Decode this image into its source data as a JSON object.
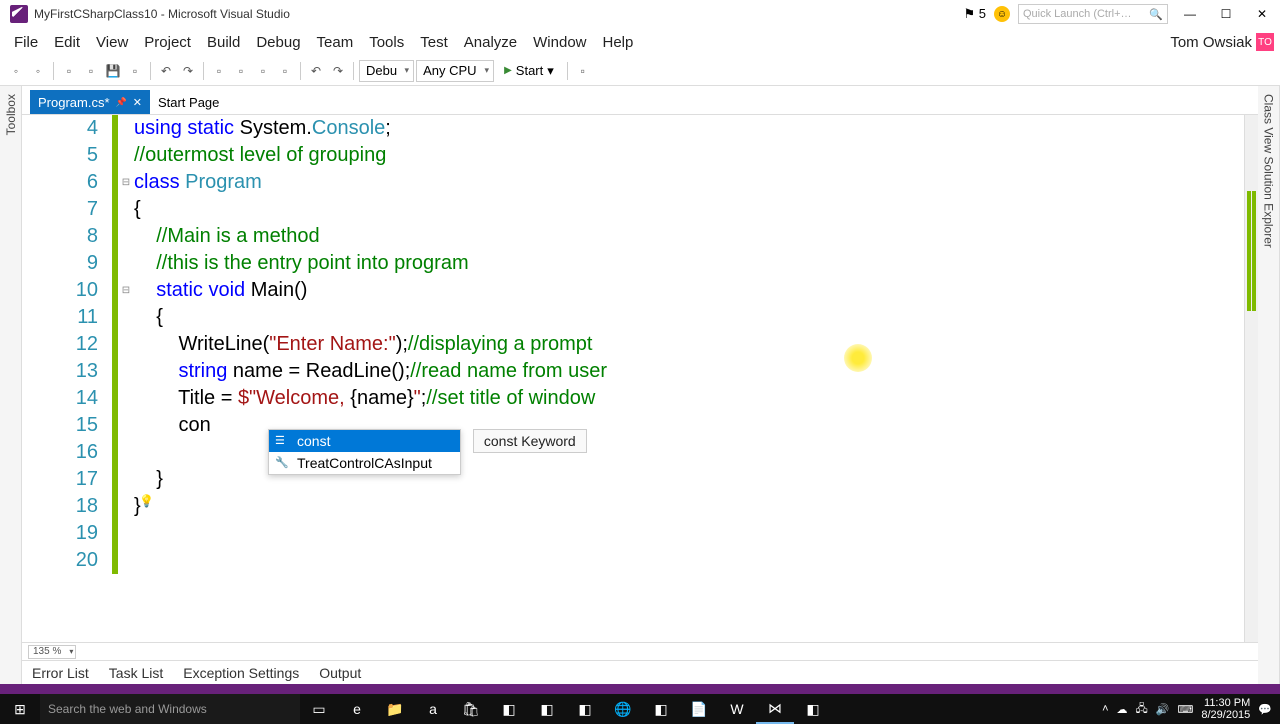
{
  "title": "MyFirstCSharpClass10 - Microsoft Visual Studio",
  "flag_count": "5",
  "quick_launch_placeholder": "Quick Launch (Ctrl+…",
  "menu": [
    "File",
    "Edit",
    "View",
    "Project",
    "Build",
    "Debug",
    "Team",
    "Tools",
    "Test",
    "Analyze",
    "Window",
    "Help"
  ],
  "user_name": "Tom Owsiak",
  "user_initials": "TO",
  "toolbar": {
    "config": "Debu",
    "platform": "Any CPU",
    "start": "Start"
  },
  "tabs": {
    "active_name": "Program.cs*",
    "other": "Start Page"
  },
  "side_left": "Toolbox",
  "side_right_top": "Class View",
  "side_right_bottom": "Solution Explorer",
  "code": {
    "4": [
      {
        "t": "using ",
        "c": "kw"
      },
      {
        "t": "static ",
        "c": "kw"
      },
      {
        "t": "System.",
        "c": "plain"
      },
      {
        "t": "Console",
        "c": "type"
      },
      {
        "t": ";",
        "c": "plain"
      }
    ],
    "5": [
      {
        "t": "//outermost level of grouping",
        "c": "cmt"
      }
    ],
    "6": [
      {
        "t": "class ",
        "c": "kw"
      },
      {
        "t": "Program",
        "c": "type"
      }
    ],
    "7": [
      {
        "t": "{",
        "c": "plain"
      }
    ],
    "8": [
      {
        "t": "    ",
        "c": "plain"
      },
      {
        "t": "//Main is a method",
        "c": "cmt"
      }
    ],
    "9": [
      {
        "t": "    ",
        "c": "plain"
      },
      {
        "t": "//this is the entry point into program",
        "c": "cmt"
      }
    ],
    "10": [
      {
        "t": "    ",
        "c": "plain"
      },
      {
        "t": "static ",
        "c": "kw"
      },
      {
        "t": "void ",
        "c": "kw"
      },
      {
        "t": "Main()",
        "c": "plain"
      }
    ],
    "11": [
      {
        "t": "    {",
        "c": "plain"
      }
    ],
    "12": [
      {
        "t": "        WriteLine(",
        "c": "plain"
      },
      {
        "t": "\"Enter Name:\"",
        "c": "str"
      },
      {
        "t": ");",
        "c": "plain"
      },
      {
        "t": "//displaying a prompt",
        "c": "cmt"
      }
    ],
    "13": [
      {
        "t": "        ",
        "c": "plain"
      },
      {
        "t": "string ",
        "c": "kw"
      },
      {
        "t": "name = ReadLine();",
        "c": "plain"
      },
      {
        "t": "//read name from user",
        "c": "cmt"
      }
    ],
    "14": [
      {
        "t": "        Title = ",
        "c": "plain"
      },
      {
        "t": "$\"Welcome, ",
        "c": "str"
      },
      {
        "t": "{name}",
        "c": "plain"
      },
      {
        "t": "\"",
        "c": "str"
      },
      {
        "t": ";",
        "c": "plain"
      },
      {
        "t": "//set title of window",
        "c": "cmt"
      }
    ],
    "15": [
      {
        "t": "        con",
        "c": "plain"
      }
    ],
    "16": [
      {
        "t": "",
        "c": "plain"
      }
    ],
    "17": [
      {
        "t": "    }",
        "c": "plain"
      }
    ],
    "18": [
      {
        "t": "}",
        "c": "plain"
      }
    ],
    "19": [
      {
        "t": "",
        "c": "plain"
      }
    ],
    "20": [
      {
        "t": "",
        "c": "plain"
      }
    ]
  },
  "line_numbers": [
    "4",
    "5",
    "6",
    "7",
    "8",
    "9",
    "10",
    "11",
    "12",
    "13",
    "14",
    "15",
    "16",
    "17",
    "18",
    "19",
    "20"
  ],
  "intellisense": {
    "items": [
      "const",
      "TreatControlCAsInput"
    ],
    "tooltip": "const Keyword"
  },
  "zoom": "135 %",
  "bottom_tabs": [
    "Error List",
    "Task List",
    "Exception Settings",
    "Output"
  ],
  "taskbar": {
    "search_placeholder": "Search the web and Windows",
    "time": "11:30 PM",
    "date": "8/29/2015"
  }
}
